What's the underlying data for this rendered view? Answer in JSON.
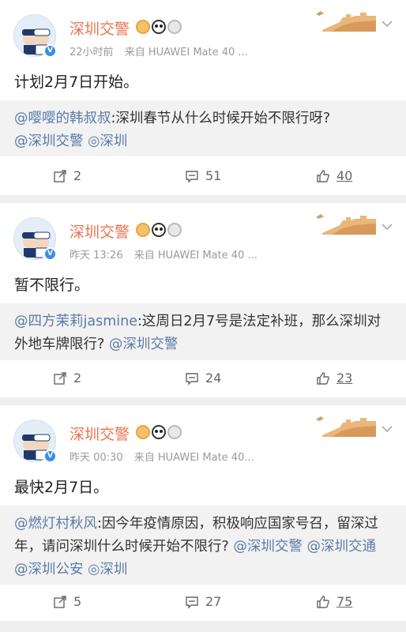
{
  "colors": {
    "username": "#eb7350",
    "link": "#5b7aa7",
    "meta": "#9a9a9a"
  },
  "posts": [
    {
      "username": "深圳交警",
      "time": "22小时前",
      "source": "来自 HUAWEI Mate 40 ...",
      "content": "计划2月7日开始。",
      "retweet": {
        "author": "@嘤嘤的韩叔叔",
        "text": ":深圳春节从什么时候开始不限行呀?",
        "tags": [
          "@深圳交警",
          "◎深圳"
        ]
      },
      "actions": {
        "share": "2",
        "comment": "51",
        "like": "40"
      }
    },
    {
      "username": "深圳交警",
      "time": "昨天 13:26",
      "source": "来自 HUAWEI Mate 40 ...",
      "content": "暂不限行。",
      "retweet": {
        "author": "@四方茉莉jasmine",
        "text": ":这周日2月7号是法定补班，那么深圳对外地车牌限行?",
        "tags": [
          "@深圳交警"
        ]
      },
      "actions": {
        "share": "2",
        "comment": "24",
        "like": "23"
      }
    },
    {
      "username": "深圳交警",
      "time": "昨天 00:30",
      "source": "来自 HUAWEI Mate 40...",
      "content": "最快2月7日。",
      "retweet": {
        "author": "@燃灯村秋风",
        "text": ":因今年疫情原因，积极响应国家号召，留深过年，请问深圳什么时候开始不限行?",
        "tags": [
          "@深圳交警",
          "@深圳交通",
          "@深圳公安",
          "◎深圳"
        ]
      },
      "actions": {
        "share": "5",
        "comment": "27",
        "like": "75"
      }
    }
  ]
}
